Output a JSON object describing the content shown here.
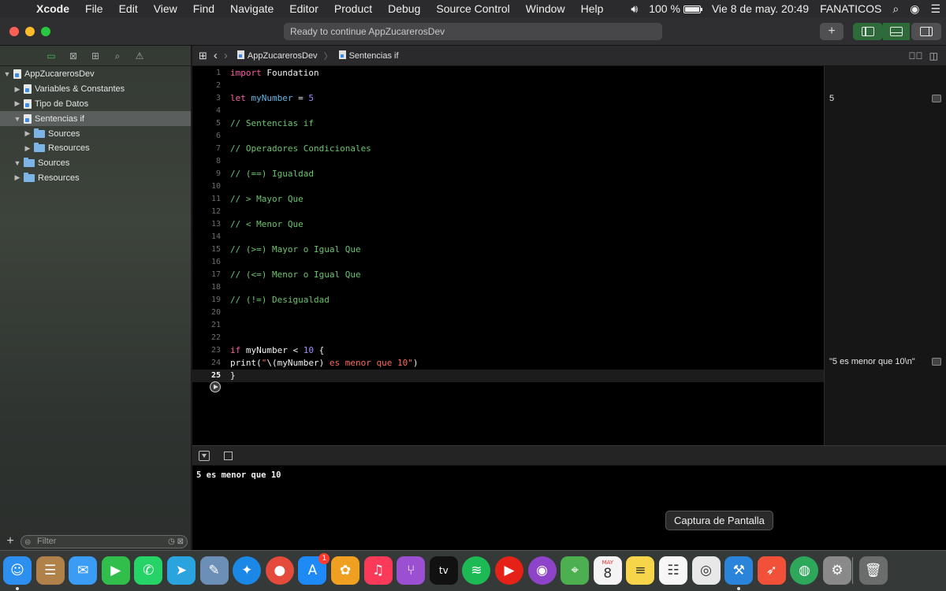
{
  "menubar": {
    "app_name": "Xcode",
    "items": [
      "File",
      "Edit",
      "View",
      "Find",
      "Navigate",
      "Editor",
      "Product",
      "Debug",
      "Source Control",
      "Window",
      "Help"
    ],
    "battery": "100 %",
    "datetime": "Vie 8 de may.  20:49",
    "user": "FANATICOS"
  },
  "toolbar": {
    "activity_status": "Ready to continue AppZucarerosDev",
    "add_label": "+"
  },
  "navigator": {
    "tree": [
      {
        "label": "AppZucarerosDev",
        "expanded": true,
        "kind": "file"
      },
      {
        "label": "Variables & Constantes",
        "expanded": false,
        "kind": "file"
      },
      {
        "label": "Tipo de Datos",
        "expanded": false,
        "kind": "file"
      },
      {
        "label": "Sentencias if",
        "expanded": true,
        "kind": "file",
        "selected": true
      },
      {
        "label": "Sources",
        "expanded": false,
        "kind": "folder"
      },
      {
        "label": "Resources",
        "expanded": false,
        "kind": "folder"
      },
      {
        "label": "Sources",
        "expanded": true,
        "kind": "folder"
      },
      {
        "label": "Resources",
        "expanded": false,
        "kind": "folder"
      }
    ],
    "filter_placeholder": "Filter"
  },
  "jumpbar": {
    "project": "AppZucarerosDev",
    "file": "Sentencias if"
  },
  "editor": {
    "current_line": 25,
    "lines": [
      [
        {
          "t": "import",
          "c": "kw"
        },
        {
          "t": " Foundation",
          "c": "plain"
        }
      ],
      [],
      [
        {
          "t": "let",
          "c": "kw"
        },
        {
          "t": " ",
          "c": "plain"
        },
        {
          "t": "myNumber",
          "c": "id"
        },
        {
          "t": " = ",
          "c": "plain"
        },
        {
          "t": "5",
          "c": "num"
        }
      ],
      [],
      [
        {
          "t": "// Sentencias if",
          "c": "cm"
        }
      ],
      [],
      [
        {
          "t": "// Operadores Condicionales",
          "c": "cm"
        }
      ],
      [],
      [
        {
          "t": "// (==) Igualdad",
          "c": "cm"
        }
      ],
      [],
      [
        {
          "t": "// > Mayor Que",
          "c": "cm"
        }
      ],
      [],
      [
        {
          "t": "// < Menor Que",
          "c": "cm"
        }
      ],
      [],
      [
        {
          "t": "// (>=) Mayor o Igual Que",
          "c": "cm"
        }
      ],
      [],
      [
        {
          "t": "// (<=) Menor o Igual Que",
          "c": "cm"
        }
      ],
      [],
      [
        {
          "t": "// (!=) Desigualdad",
          "c": "cm"
        }
      ],
      [],
      [],
      [],
      [
        {
          "t": "if",
          "c": "kw"
        },
        {
          "t": " myNumber < ",
          "c": "plain"
        },
        {
          "t": "10",
          "c": "num"
        },
        {
          "t": " {",
          "c": "plain"
        }
      ],
      [
        {
          "t": "print(",
          "c": "plain"
        },
        {
          "t": "\"",
          "c": "str"
        },
        {
          "t": "\\(myNumber)",
          "c": "plain"
        },
        {
          "t": " es menor que 10\"",
          "c": "str"
        },
        {
          "t": ")",
          "c": "plain"
        }
      ],
      [
        {
          "t": "}",
          "c": "plain"
        }
      ]
    ]
  },
  "results": [
    {
      "line": 3,
      "value": "5"
    },
    {
      "line": 24,
      "value": "\"5 es menor que 10\\n\""
    }
  ],
  "console": {
    "output": "5 es menor que 10"
  },
  "tooltip": {
    "text": "Captura de Pantalla"
  },
  "dock": {
    "items": [
      {
        "name": "finder",
        "glyph": "☺",
        "color": "#2d8ff0",
        "running": true
      },
      {
        "name": "contacts",
        "glyph": "☰",
        "color": "#b0824a",
        "running": false
      },
      {
        "name": "messages",
        "glyph": "✉",
        "color": "#3b9cf5",
        "running": false
      },
      {
        "name": "facetime",
        "glyph": "▶",
        "color": "#2fbf4a",
        "running": false
      },
      {
        "name": "whatsapp",
        "glyph": "✆",
        "color": "#25d366",
        "running": false
      },
      {
        "name": "telegram",
        "glyph": "➤",
        "color": "#2aa3df",
        "running": false
      },
      {
        "name": "preview",
        "glyph": "✎",
        "color": "#6c8fb8",
        "running": false
      },
      {
        "name": "safari",
        "glyph": "✦",
        "color": "#1b87e6",
        "running": false
      },
      {
        "name": "chrome",
        "glyph": "●",
        "color": "#e44b3c",
        "running": false
      },
      {
        "name": "app-store",
        "glyph": "A",
        "color": "#1d8af5",
        "running": false,
        "badge": "1"
      },
      {
        "name": "photos",
        "glyph": "✿",
        "color": "#f0a020",
        "running": false
      },
      {
        "name": "music",
        "glyph": "♫",
        "color": "#fb3a5a",
        "running": false
      },
      {
        "name": "sourcetree",
        "glyph": "⑂",
        "color": "#9b4fd1",
        "running": false
      },
      {
        "name": "apple-tv",
        "glyph": "tv",
        "color": "#111111",
        "running": false
      },
      {
        "name": "spotify",
        "glyph": "≋",
        "color": "#1db954",
        "running": false
      },
      {
        "name": "youtube",
        "glyph": "▶",
        "color": "#e62117",
        "running": false
      },
      {
        "name": "podcasts",
        "glyph": "◉",
        "color": "#8e44c9",
        "running": false
      },
      {
        "name": "maps",
        "glyph": "⌖",
        "color": "#4caf50",
        "running": false
      },
      {
        "name": "calendar",
        "glyph": "8",
        "color": "#f4f4f4",
        "running": false,
        "dark_text": true,
        "caption": "MAY"
      },
      {
        "name": "notes",
        "glyph": "≡",
        "color": "#f7d54a",
        "running": false,
        "dark_text": true
      },
      {
        "name": "reminders",
        "glyph": "☷",
        "color": "#f7f7f7",
        "running": false,
        "dark_text": true
      },
      {
        "name": "screenshot",
        "glyph": "◎",
        "color": "#e8e8e8",
        "running": false,
        "dark_text": true
      },
      {
        "name": "xcode",
        "glyph": "⚒",
        "color": "#2a84d9",
        "running": true
      },
      {
        "name": "swift-playgrounds",
        "glyph": "➶",
        "color": "#f05138",
        "running": false
      },
      {
        "name": "itunes-connect",
        "glyph": "◍",
        "color": "#2da85a",
        "running": false
      },
      {
        "name": "system-preferences",
        "glyph": "⚙",
        "color": "#8a8a8a",
        "running": false
      },
      {
        "name": "trash",
        "glyph": "🗑",
        "color": "#6a6d6c",
        "running": false
      }
    ]
  },
  "colors": {
    "keyword": "#fc5fa3",
    "identifier": "#67b7e6",
    "comment": "#6bc46d",
    "number": "#9f8efa",
    "string": "#fc6a5d"
  }
}
